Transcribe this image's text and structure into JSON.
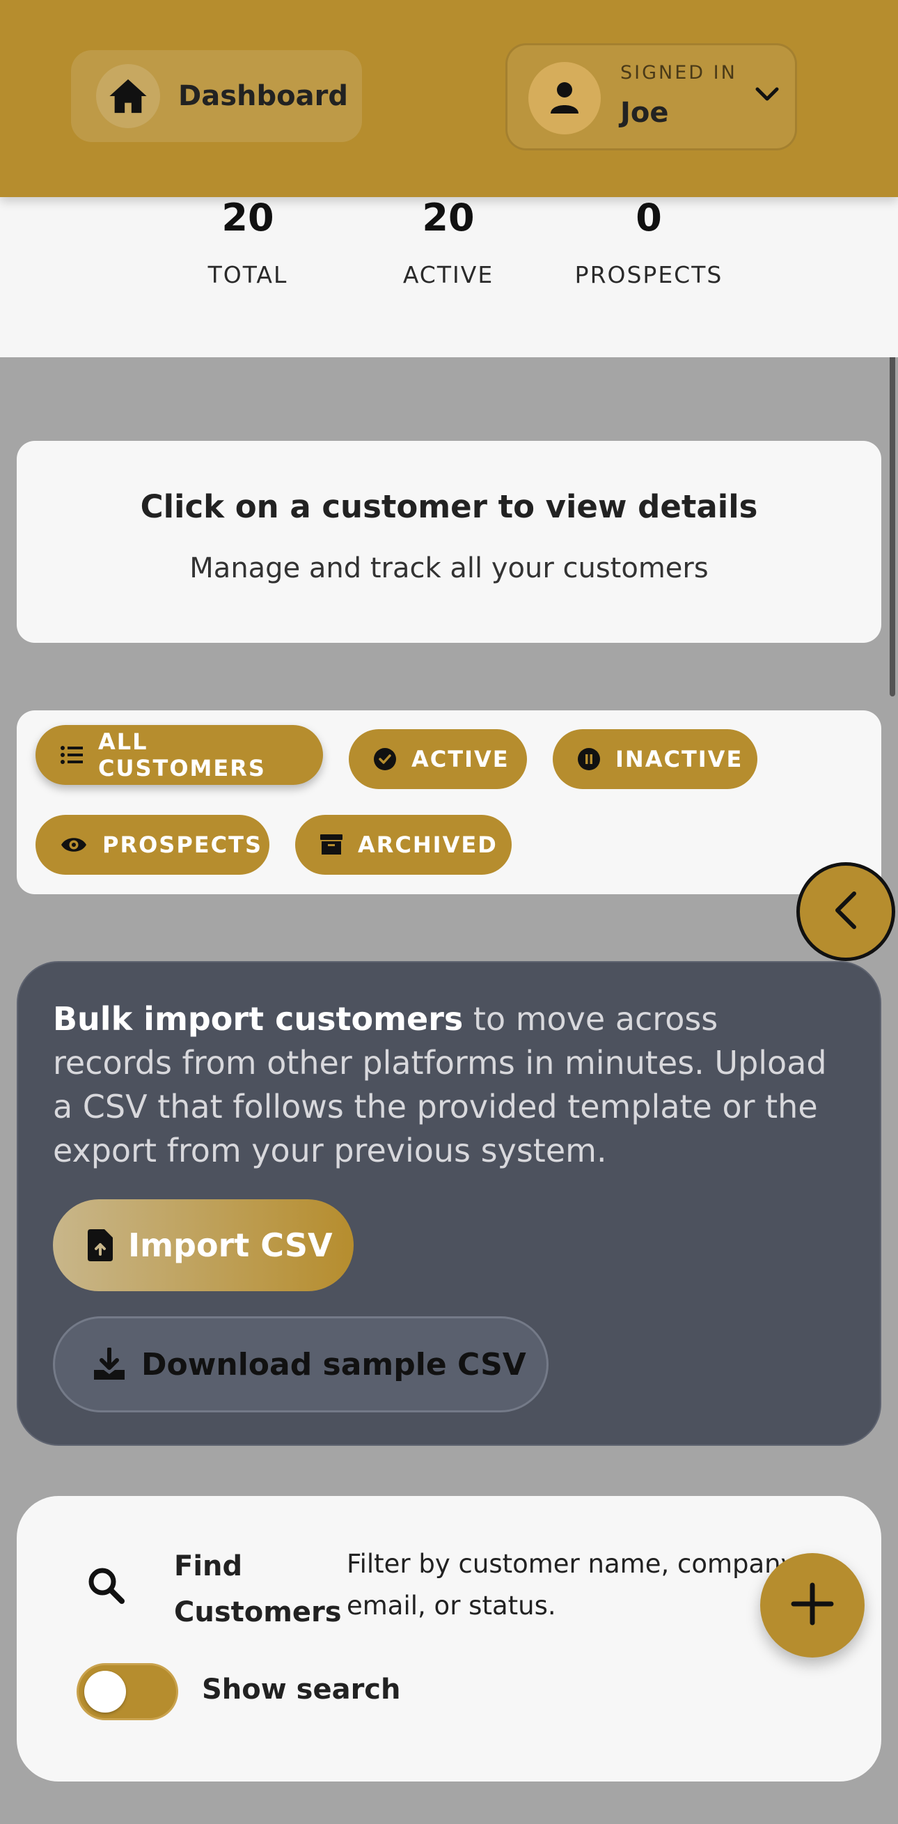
{
  "header": {
    "dashboard_label": "Dashboard",
    "signed_in_label": "SIGNED IN",
    "user_name": "Joe"
  },
  "stats": [
    {
      "value": "20",
      "label": "TOTAL"
    },
    {
      "value": "20",
      "label": "ACTIVE"
    },
    {
      "value": "0",
      "label": "PROSPECTS"
    }
  ],
  "info": {
    "title": "Click on a customer to view details",
    "subtitle": "Manage and track all your customers"
  },
  "filters": [
    {
      "label": "ALL CUSTOMERS",
      "icon": "list-icon",
      "selected": true
    },
    {
      "label": "ACTIVE",
      "icon": "check-circle-icon"
    },
    {
      "label": "INACTIVE",
      "icon": "pause-circle-icon"
    },
    {
      "label": "PROSPECTS",
      "icon": "eye-icon"
    },
    {
      "label": "ARCHIVED",
      "icon": "archive-box-icon"
    }
  ],
  "import": {
    "heading": "Bulk import customers",
    "text": " to move across records from other platforms in minutes. Upload a CSV that follows the provided template or the export from your previous system.",
    "import_label": "Import CSV",
    "download_label": "Download sample CSV"
  },
  "search": {
    "title": "Find Customers",
    "description": "Filter by customer name, company, email, or status.",
    "toggle_label": "Show search",
    "toggle_on": false
  },
  "colors": {
    "accent": "#b68d2e",
    "import_card": "#4d525e",
    "background": "#a5a5a5"
  }
}
